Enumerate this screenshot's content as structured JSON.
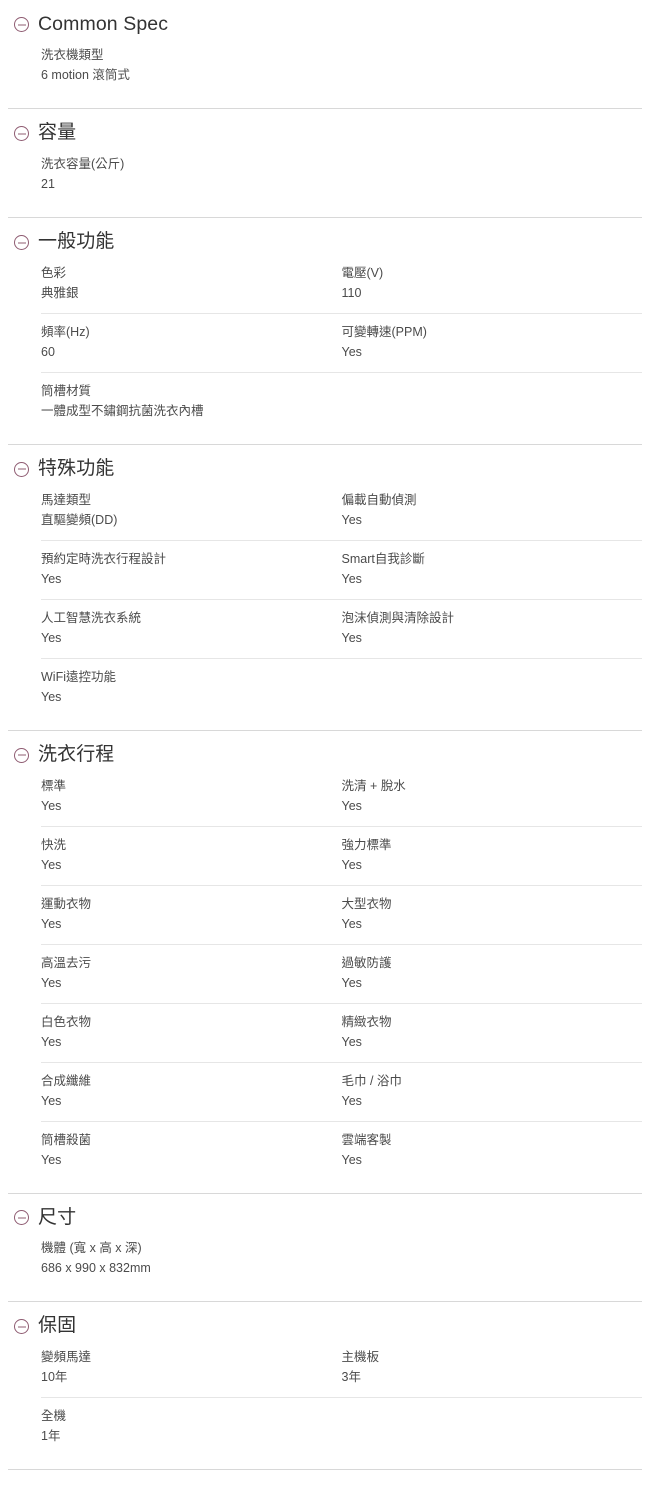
{
  "accent_color": "#8f5c72",
  "text_color": "#4b4b4b",
  "heading_color": "#333333",
  "divider_color": "#d8d8d8",
  "row_divider_color": "#e6e6e6",
  "toggle_icon": "minus-circle-icon",
  "sections": [
    {
      "id": "common-spec",
      "title": "Common Spec",
      "latin": true,
      "rows": [
        [
          {
            "label": "洗衣機類型",
            "value": "6 motion 滾筒式"
          }
        ]
      ]
    },
    {
      "id": "capacity",
      "title": "容量",
      "latin": false,
      "rows": [
        [
          {
            "label": "洗衣容量(公斤)",
            "value": "21"
          }
        ]
      ]
    },
    {
      "id": "general-function",
      "title": "一般功能",
      "latin": false,
      "rows": [
        [
          {
            "label": "色彩",
            "value": "典雅銀"
          },
          {
            "label": "電壓(V)",
            "value": "110"
          }
        ],
        [
          {
            "label": "頻率(Hz)",
            "value": "60"
          },
          {
            "label": "可變轉速(PPM)",
            "value": "Yes"
          }
        ],
        [
          {
            "label": "筒槽材質",
            "value": "一體成型不鏽鋼抗菌洗衣內槽"
          }
        ]
      ]
    },
    {
      "id": "special-function",
      "title": "特殊功能",
      "latin": false,
      "rows": [
        [
          {
            "label": "馬達類型",
            "value": "直驅變頻(DD)"
          },
          {
            "label": "偏載自動偵測",
            "value": "Yes"
          }
        ],
        [
          {
            "label": "預約定時洗衣行程設計",
            "value": "Yes"
          },
          {
            "label": "Smart自我診斷",
            "value": "Yes"
          }
        ],
        [
          {
            "label": "人工智慧洗衣系統",
            "value": "Yes"
          },
          {
            "label": "泡沫偵測與清除設計",
            "value": "Yes"
          }
        ],
        [
          {
            "label": "WiFi遠控功能",
            "value": "Yes"
          }
        ]
      ]
    },
    {
      "id": "wash-cycle",
      "title": "洗衣行程",
      "latin": false,
      "rows": [
        [
          {
            "label": "標準",
            "value": "Yes"
          },
          {
            "label": "洗清 + 脫水",
            "value": "Yes"
          }
        ],
        [
          {
            "label": "快洗",
            "value": "Yes"
          },
          {
            "label": "強力標準",
            "value": "Yes"
          }
        ],
        [
          {
            "label": "運動衣物",
            "value": "Yes"
          },
          {
            "label": "大型衣物",
            "value": "Yes"
          }
        ],
        [
          {
            "label": "高溫去污",
            "value": "Yes"
          },
          {
            "label": "過敏防護",
            "value": "Yes"
          }
        ],
        [
          {
            "label": "白色衣物",
            "value": "Yes"
          },
          {
            "label": "精緻衣物",
            "value": "Yes"
          }
        ],
        [
          {
            "label": "合成纖維",
            "value": "Yes"
          },
          {
            "label": "毛巾 / 浴巾",
            "value": "Yes"
          }
        ],
        [
          {
            "label": "筒槽殺菌",
            "value": "Yes"
          },
          {
            "label": "雲端客製",
            "value": "Yes"
          }
        ]
      ]
    },
    {
      "id": "dimension",
      "title": "尺寸",
      "latin": false,
      "rows": [
        [
          {
            "label": "機體 (寬 x 高 x 深)",
            "value": "686 x 990 x 832mm"
          }
        ]
      ]
    },
    {
      "id": "warranty",
      "title": "保固",
      "latin": false,
      "rows": [
        [
          {
            "label": "變頻馬達",
            "value": "10年"
          },
          {
            "label": "主機板",
            "value": "3年"
          }
        ],
        [
          {
            "label": "全機",
            "value": "1年"
          }
        ]
      ]
    }
  ]
}
